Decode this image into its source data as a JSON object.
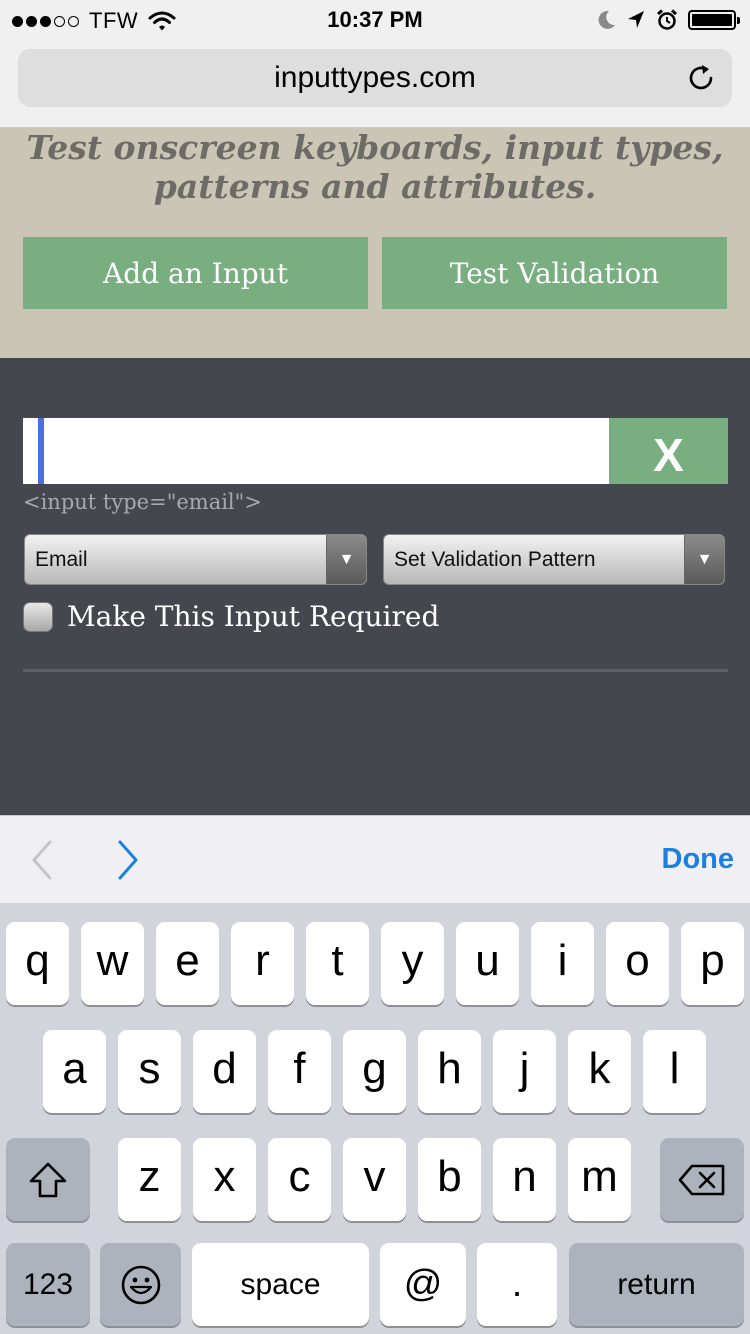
{
  "status_bar": {
    "carrier": "TFW",
    "signal_bars_filled": 3,
    "signal_bars_total": 5,
    "time": "10:37 PM",
    "battery_level": 1.0,
    "icons": [
      "wifi-icon",
      "moon-icon",
      "location-icon",
      "alarm-icon",
      "battery-icon"
    ]
  },
  "browser": {
    "url": "inputtypes.com",
    "reload_icon": "reload-icon"
  },
  "page": {
    "tagline_line1": "Test onscreen keyboards, input types,",
    "tagline_line2": "patterns and attributes.",
    "add_input_label": "Add an Input",
    "test_validation_label": "Test Validation",
    "input_value": "",
    "clear_label": "X",
    "input_caption": "<input type=\"email\">",
    "type_select_value": "Email",
    "pattern_select_value": "Set Validation Pattern",
    "required_label": "Make This Input Required",
    "required_checked": false
  },
  "accessory_bar": {
    "done_label": "Done"
  },
  "keyboard": {
    "row1": [
      "q",
      "w",
      "e",
      "r",
      "t",
      "y",
      "u",
      "i",
      "o",
      "p"
    ],
    "row2": [
      "a",
      "s",
      "d",
      "f",
      "g",
      "h",
      "j",
      "k",
      "l"
    ],
    "row3": [
      "z",
      "x",
      "c",
      "v",
      "b",
      "n",
      "m"
    ],
    "numbers_label": "123",
    "space_label": "space",
    "at_label": "@",
    "dot_label": ".",
    "return_label": "return"
  },
  "colors": {
    "accent_green": "#79af80",
    "header_bg": "#cbc5b5",
    "dark_bg": "#45474f",
    "ios_blue": "#1a7fe0",
    "caret_blue": "#4a6fe3"
  }
}
